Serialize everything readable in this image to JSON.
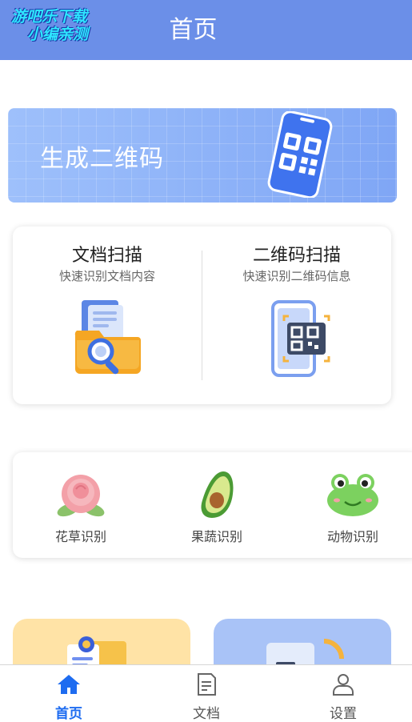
{
  "watermark": {
    "line1": "游吧乐下载",
    "line2": "小编亲测"
  },
  "header": {
    "title": "首页"
  },
  "banner": {
    "label": "生成二维码"
  },
  "scan": {
    "items": [
      {
        "title": "文档扫描",
        "subtitle": "快速识别文档内容",
        "icon": "document-folder-search-icon"
      },
      {
        "title": "二维码扫描",
        "subtitle": "快速识别二维码信息",
        "icon": "phone-qr-scan-icon"
      }
    ]
  },
  "recognition": {
    "items": [
      {
        "label": "花草识别",
        "icon": "rose-icon"
      },
      {
        "label": "果蔬识别",
        "icon": "avocado-icon"
      },
      {
        "label": "动物识别",
        "icon": "frog-icon"
      }
    ]
  },
  "tabbar": {
    "items": [
      {
        "label": "首页",
        "icon": "home-icon",
        "active": true
      },
      {
        "label": "文档",
        "icon": "document-icon",
        "active": false
      },
      {
        "label": "设置",
        "icon": "user-icon",
        "active": false
      }
    ]
  },
  "colors": {
    "header": "#6b8fe8",
    "banner": "#8fb3f8",
    "active_tab": "#1e6cf0",
    "bottom_card_left": "#ffe3a6",
    "bottom_card_right": "#a9c3f7"
  }
}
